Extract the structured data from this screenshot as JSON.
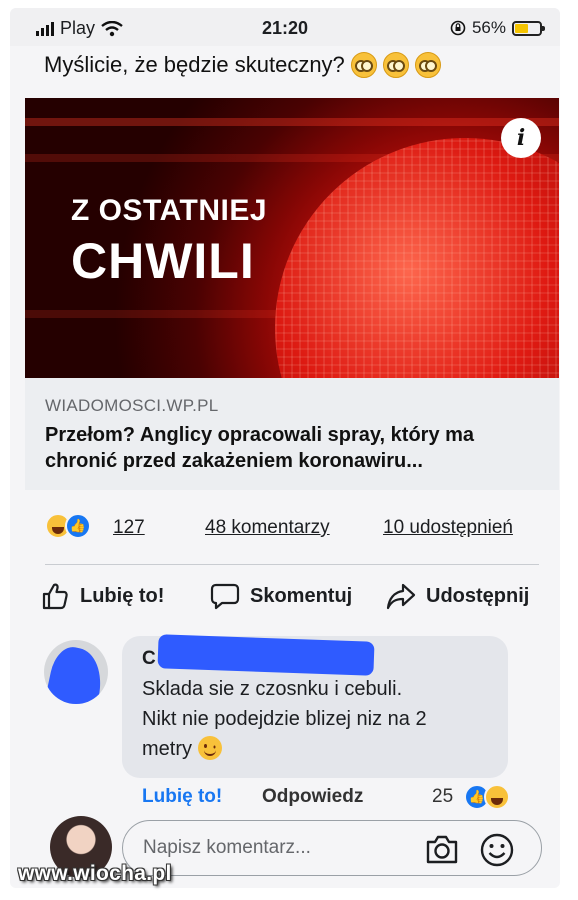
{
  "status_bar": {
    "carrier": "Play",
    "time": "21:20",
    "battery": "56%",
    "battery_level": 0.56
  },
  "post": {
    "text": "Myślicie, że będzie skuteczny?",
    "emoji_icon": "monocle-face-icon"
  },
  "link_card": {
    "image_line1": "Z OSTATNIEJ",
    "image_line2": "CHWILI",
    "domain": "WIADOMOSCI.WP.PL",
    "headline": "Przełom? Anglicy opracowali spray, który ma chronić przed zakażeniem koronawiru..."
  },
  "reactions": {
    "count": "127",
    "comments": "48 komentarzy",
    "shares": "10 udostępnień"
  },
  "actions": {
    "like": "Lubię to!",
    "comment": "Skomentuj",
    "share": "Udostępnij"
  },
  "comment": {
    "author_initial": "C",
    "text_line1": "Sklada sie z czosnku i cebuli.",
    "text_line2": "Nikt nie podejdzie blizej niz na 2",
    "text_line3": "metry",
    "like": "Lubię to!",
    "reply": "Odpowiedz",
    "reaction_count": "25"
  },
  "composer": {
    "placeholder": "Napisz komentarz..."
  },
  "watermark": "www.wiocha.pl",
  "colors": {
    "facebook_blue": "#1877f2",
    "news_red": "#d21510",
    "bubble": "#e4e6eb"
  }
}
